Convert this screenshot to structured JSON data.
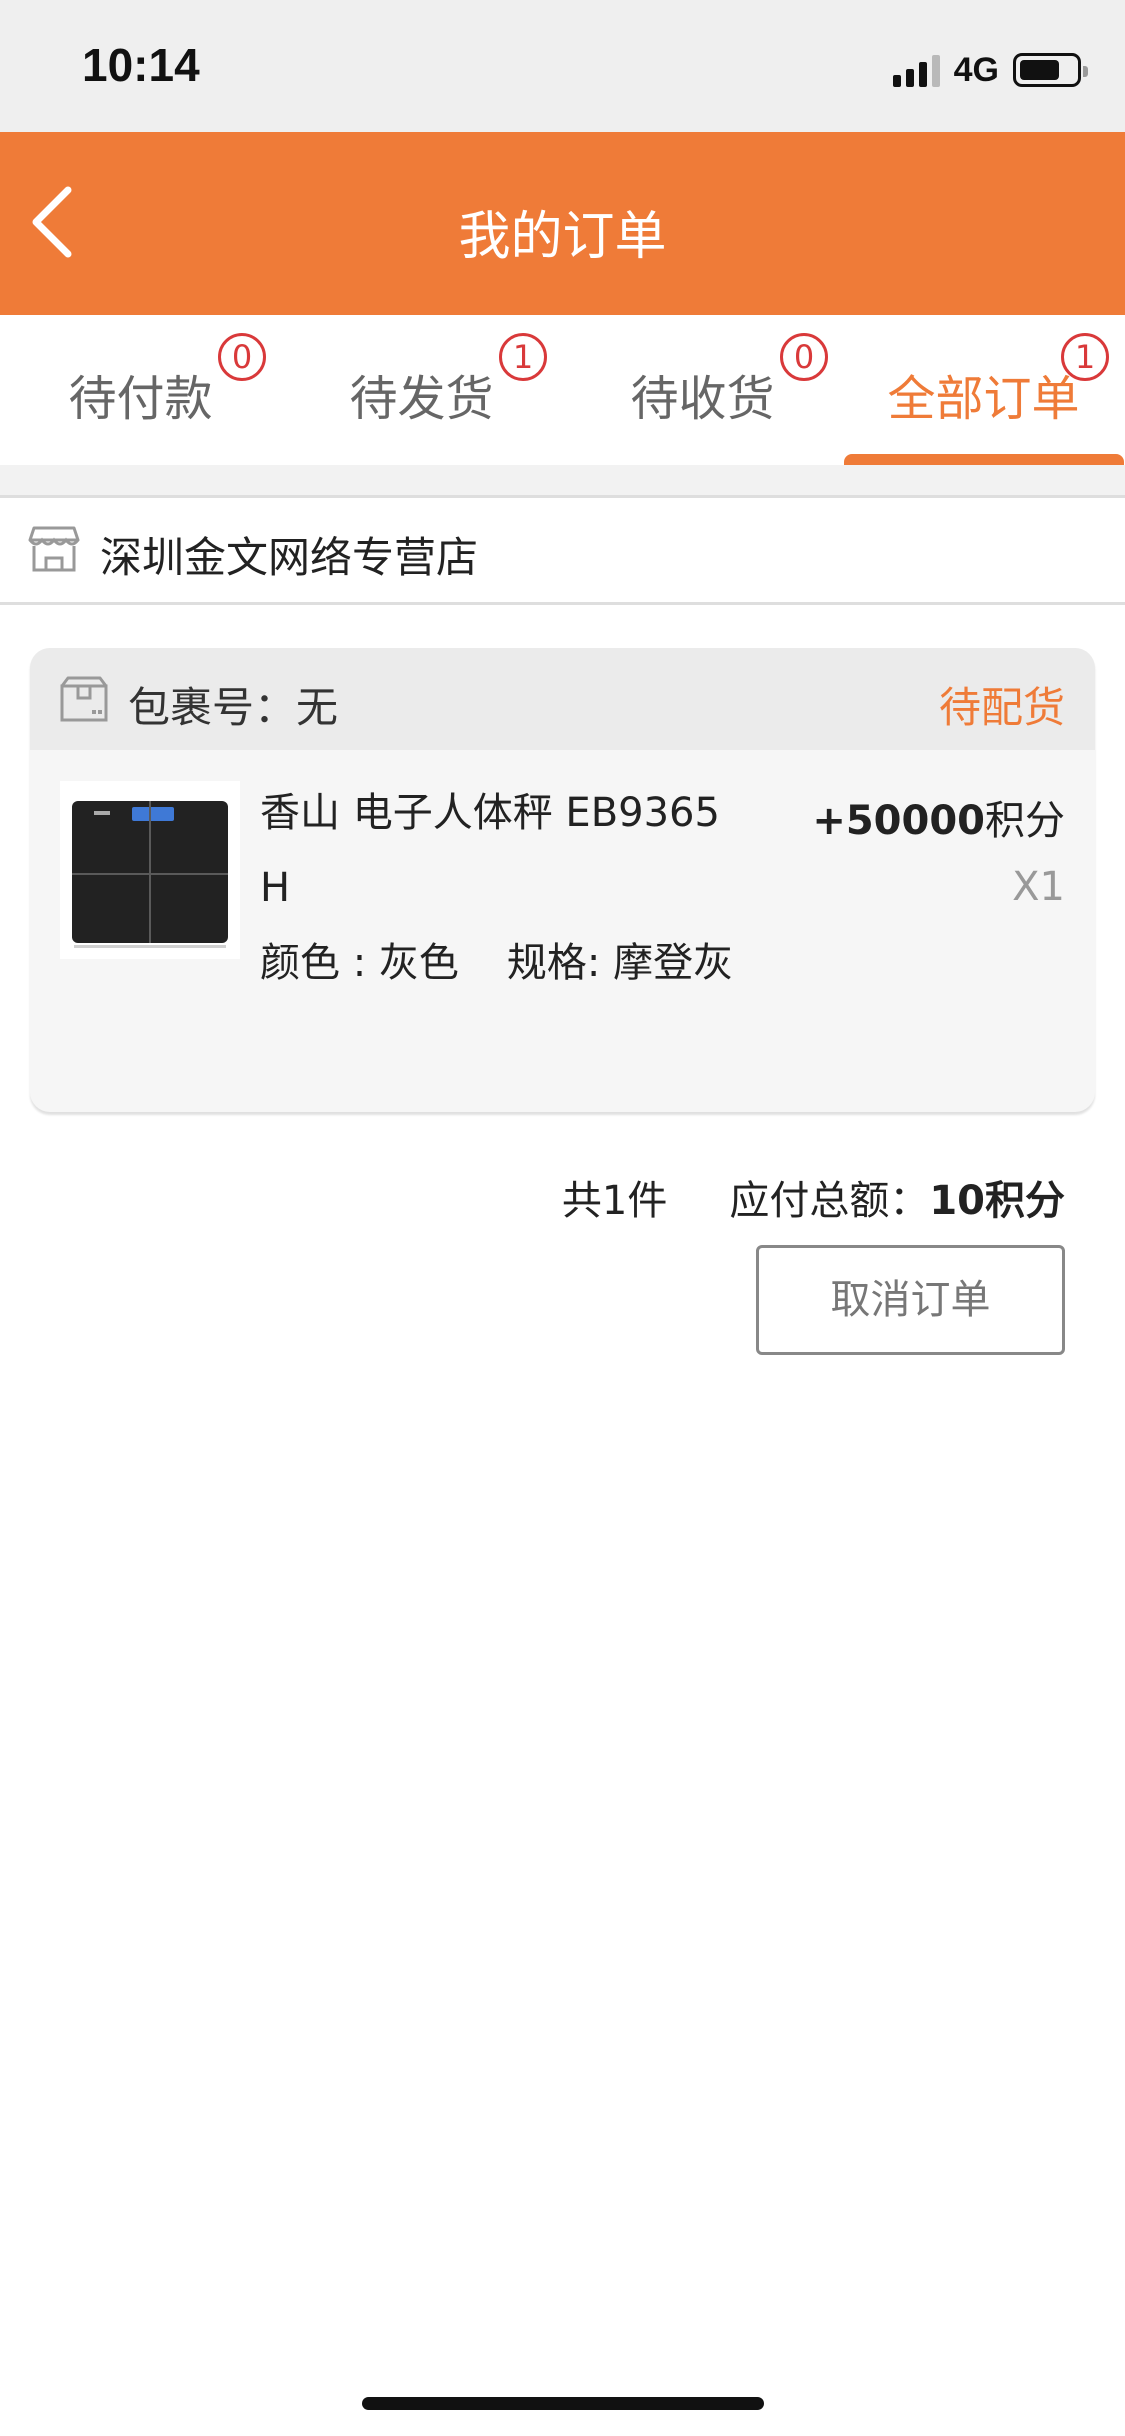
{
  "status_bar": {
    "time": "10:14",
    "network": "4G",
    "battery_level": 0.7
  },
  "header": {
    "title": "我的订单"
  },
  "tabs": [
    {
      "label": "待付款",
      "badge": "0"
    },
    {
      "label": "待发货",
      "badge": "1"
    },
    {
      "label": "待收货",
      "badge": "0"
    },
    {
      "label": "全部订单",
      "badge": "1"
    }
  ],
  "active_tab": "全部订单",
  "store": {
    "name": "深圳金文网络专营店"
  },
  "package": {
    "label": "包裹号：无",
    "status": "待配货",
    "item": {
      "name": "香山 电子人体秤 EB9365H",
      "color": "颜色 : 灰色",
      "spec": "规格: 摩登灰",
      "price_amount": "+50000",
      "price_unit": "积分",
      "quantity": "X1"
    }
  },
  "summary": {
    "count": "共1件",
    "total_label": "应付总额：",
    "total_value": "10积分"
  },
  "actions": {
    "cancel_label": "取消订单"
  },
  "colors": {
    "accent": "#ef7b38",
    "badge": "#d9393a",
    "background": "#ffffff"
  }
}
